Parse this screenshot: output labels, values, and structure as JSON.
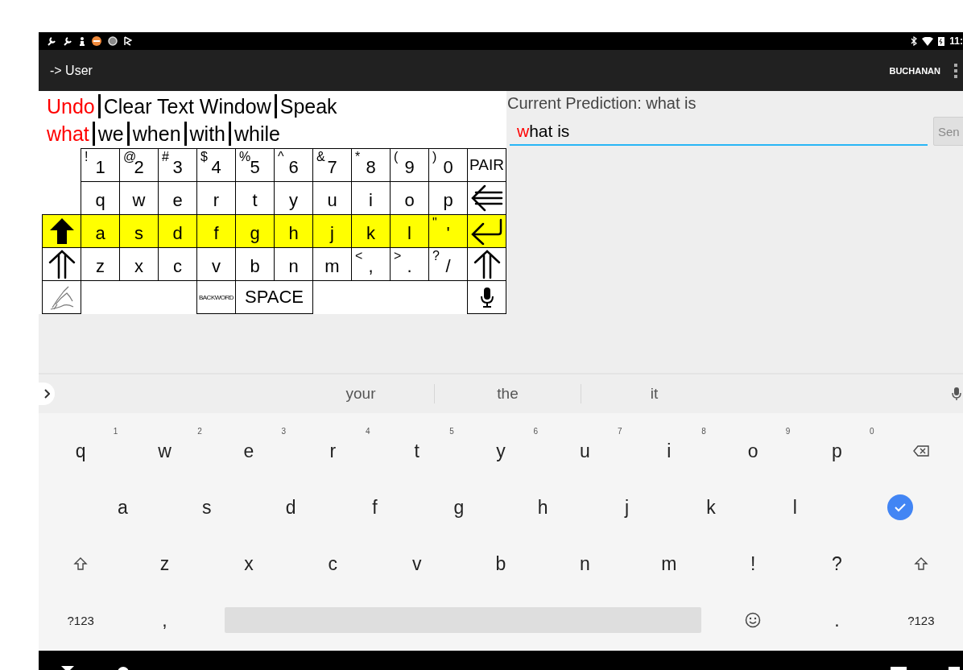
{
  "status_bar": {
    "time": "11:"
  },
  "action_bar": {
    "title": "-> User",
    "account": "BUCHANAN"
  },
  "commands": [
    {
      "label": "Undo",
      "color": "#ff0000"
    },
    {
      "label": "Clear Text Window",
      "color": "#000000"
    },
    {
      "label": "Speak",
      "color": "#000000"
    }
  ],
  "word_predictions": [
    {
      "label": "what",
      "color": "#ff0000"
    },
    {
      "label": "we",
      "color": "#000000"
    },
    {
      "label": "when",
      "color": "#000000"
    },
    {
      "label": "with",
      "color": "#000000"
    },
    {
      "label": "while",
      "color": "#000000"
    }
  ],
  "key_rows": [
    {
      "highlighted": false,
      "keys": [
        {
          "kind": "blank"
        },
        {
          "kind": "char",
          "label": "1",
          "shift": "!"
        },
        {
          "kind": "char",
          "label": "2",
          "shift": "@"
        },
        {
          "kind": "char",
          "label": "3",
          "shift": "#"
        },
        {
          "kind": "char",
          "label": "4",
          "shift": "$"
        },
        {
          "kind": "char",
          "label": "5",
          "shift": "%"
        },
        {
          "kind": "char",
          "label": "6",
          "shift": "^"
        },
        {
          "kind": "char",
          "label": "7",
          "shift": "&"
        },
        {
          "kind": "char",
          "label": "8",
          "shift": "*"
        },
        {
          "kind": "char",
          "label": "9",
          "shift": "("
        },
        {
          "kind": "char",
          "label": "0",
          "shift": ")"
        },
        {
          "kind": "text",
          "label": "PAIR"
        }
      ]
    },
    {
      "highlighted": false,
      "keys": [
        {
          "kind": "blank"
        },
        {
          "kind": "char",
          "label": "q"
        },
        {
          "kind": "char",
          "label": "w"
        },
        {
          "kind": "char",
          "label": "e"
        },
        {
          "kind": "char",
          "label": "r"
        },
        {
          "kind": "char",
          "label": "t"
        },
        {
          "kind": "char",
          "label": "y"
        },
        {
          "kind": "char",
          "label": "u"
        },
        {
          "kind": "char",
          "label": "i"
        },
        {
          "kind": "char",
          "label": "o"
        },
        {
          "kind": "char",
          "label": "p"
        },
        {
          "kind": "backspace"
        }
      ]
    },
    {
      "highlighted": true,
      "keys": [
        {
          "kind": "capslock"
        },
        {
          "kind": "char",
          "label": "a"
        },
        {
          "kind": "char",
          "label": "s"
        },
        {
          "kind": "char",
          "label": "d"
        },
        {
          "kind": "char",
          "label": "f"
        },
        {
          "kind": "char",
          "label": "g"
        },
        {
          "kind": "char",
          "label": "h"
        },
        {
          "kind": "char",
          "label": "j"
        },
        {
          "kind": "char",
          "label": "k"
        },
        {
          "kind": "char",
          "label": "l"
        },
        {
          "kind": "char",
          "label": "'",
          "shift": "\""
        },
        {
          "kind": "enter"
        }
      ]
    },
    {
      "highlighted": false,
      "keys": [
        {
          "kind": "shift"
        },
        {
          "kind": "char",
          "label": "z"
        },
        {
          "kind": "char",
          "label": "x"
        },
        {
          "kind": "char",
          "label": "c"
        },
        {
          "kind": "char",
          "label": "v"
        },
        {
          "kind": "char",
          "label": "b"
        },
        {
          "kind": "char",
          "label": "n"
        },
        {
          "kind": "char",
          "label": "m"
        },
        {
          "kind": "char",
          "label": ",",
          "shift": "<"
        },
        {
          "kind": "char",
          "label": ".",
          "shift": ">"
        },
        {
          "kind": "char",
          "label": "/",
          "shift": "?"
        },
        {
          "kind": "shift"
        }
      ]
    },
    {
      "highlighted": false,
      "keys": [
        {
          "kind": "handwriting"
        },
        {
          "kind": "blank"
        },
        {
          "kind": "blank"
        },
        {
          "kind": "blank"
        },
        {
          "kind": "small",
          "label": "BACKWORD"
        },
        {
          "kind": "wide",
          "label": "SPACE"
        },
        {
          "kind": "blank"
        },
        {
          "kind": "blank"
        },
        {
          "kind": "blank"
        },
        {
          "kind": "blank"
        },
        {
          "kind": "mic"
        }
      ]
    }
  ],
  "prediction_panel": {
    "label": "Current Prediction: what is",
    "input_parts": [
      {
        "text": "w",
        "color": "#ff0000"
      },
      {
        "text": "hat is",
        "color": "#000000"
      }
    ],
    "send": {
      "label": "Sen",
      "disabled": true
    }
  },
  "soft_keyboard": {
    "suggestions": [
      "your",
      "the",
      "it"
    ],
    "rows": [
      {
        "indented": false,
        "keys": [
          {
            "kind": "char",
            "label": "q",
            "hint": "1"
          },
          {
            "kind": "char",
            "label": "w",
            "hint": "2"
          },
          {
            "kind": "char",
            "label": "e",
            "hint": "3"
          },
          {
            "kind": "char",
            "label": "r",
            "hint": "4"
          },
          {
            "kind": "char",
            "label": "t",
            "hint": "5"
          },
          {
            "kind": "char",
            "label": "y",
            "hint": "6"
          },
          {
            "kind": "char",
            "label": "u",
            "hint": "7"
          },
          {
            "kind": "char",
            "label": "i",
            "hint": "8"
          },
          {
            "kind": "char",
            "label": "o",
            "hint": "9"
          },
          {
            "kind": "char",
            "label": "p",
            "hint": "0"
          },
          {
            "kind": "backspace"
          }
        ]
      },
      {
        "indented": true,
        "keys": [
          {
            "kind": "char",
            "label": "a"
          },
          {
            "kind": "char",
            "label": "s"
          },
          {
            "kind": "char",
            "label": "d"
          },
          {
            "kind": "char",
            "label": "f"
          },
          {
            "kind": "char",
            "label": "g"
          },
          {
            "kind": "char",
            "label": "h"
          },
          {
            "kind": "char",
            "label": "j"
          },
          {
            "kind": "char",
            "label": "k"
          },
          {
            "kind": "char",
            "label": "l"
          },
          {
            "kind": "enter"
          }
        ]
      },
      {
        "indented": false,
        "keys": [
          {
            "kind": "shift"
          },
          {
            "kind": "char",
            "label": "z"
          },
          {
            "kind": "char",
            "label": "x"
          },
          {
            "kind": "char",
            "label": "c"
          },
          {
            "kind": "char",
            "label": "v"
          },
          {
            "kind": "char",
            "label": "b"
          },
          {
            "kind": "char",
            "label": "n"
          },
          {
            "kind": "char",
            "label": "m"
          },
          {
            "kind": "char",
            "label": "!"
          },
          {
            "kind": "char",
            "label": "?"
          },
          {
            "kind": "shift"
          }
        ]
      },
      {
        "indented": false,
        "keys": [
          {
            "kind": "symbols",
            "label": "?123"
          },
          {
            "kind": "char",
            "label": ","
          },
          {
            "kind": "space"
          },
          {
            "kind": "emoji"
          },
          {
            "kind": "char",
            "label": "."
          },
          {
            "kind": "symbols",
            "label": "?123"
          }
        ]
      }
    ]
  }
}
